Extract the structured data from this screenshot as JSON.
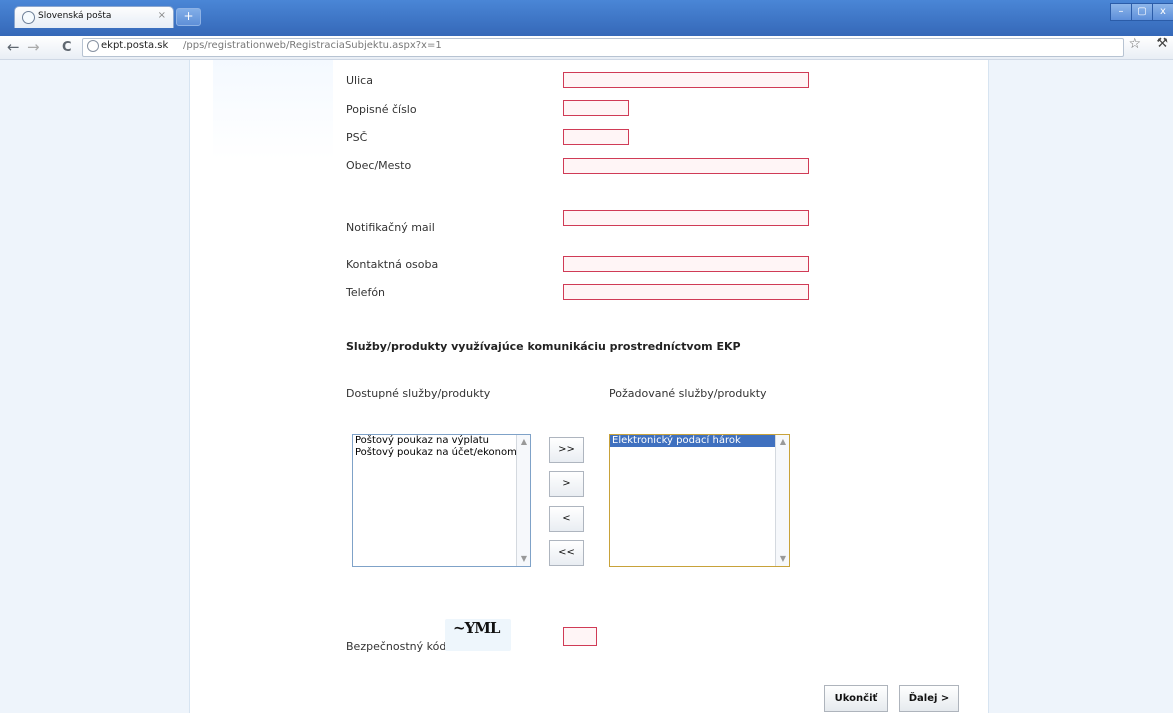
{
  "browser": {
    "tab_title": "Slovenská pošta",
    "tab_close": "×",
    "new_tab": "+",
    "window_minimize": "–",
    "window_restore": "▢",
    "window_close": "x",
    "url_domain": "ekpt.posta.sk",
    "url_path": "/pps/registrationweb/RegistraciaSubjektu.aspx?x=1",
    "back": "←",
    "forward": "→",
    "reload": "C",
    "star": "☆",
    "wrench": "⚒"
  },
  "form": {
    "labels": {
      "ulica": "Ulica",
      "popisne_cislo": "Popisné číslo",
      "psc": "PSČ",
      "obec_mesto": "Obec/Mesto",
      "notifikacny_mail": "Notifikačný mail",
      "kontaktna_osoba": "Kontaktná osoba",
      "telefon": "Telefón",
      "bezpecnostny_kod": "Bezpečnostný kód"
    },
    "values": {
      "ulica": "",
      "popisne_cislo": "",
      "psc": "",
      "obec_mesto": "",
      "notifikacny_mail": "",
      "kontaktna_osoba": "",
      "telefon": "",
      "captcha_input": ""
    },
    "services": {
      "title": "Služby/produkty využívajúce komunikáciu prostredníctvom EKP",
      "available_label": "Dostupné služby/produkty",
      "requested_label": "Požadované služby/produkty",
      "available_items": [
        "Poštový poukaz na výplatu",
        "Poštový poukaz na účet/ekonomic"
      ],
      "requested_items": [
        "Elektronický podací hárok"
      ],
      "move_all_right": ">>",
      "move_right": ">",
      "move_left": "<",
      "move_all_left": "<<"
    },
    "captcha_text": "~YML",
    "buttons": {
      "cancel": "Ukončiť",
      "next": "Ďalej >"
    }
  }
}
